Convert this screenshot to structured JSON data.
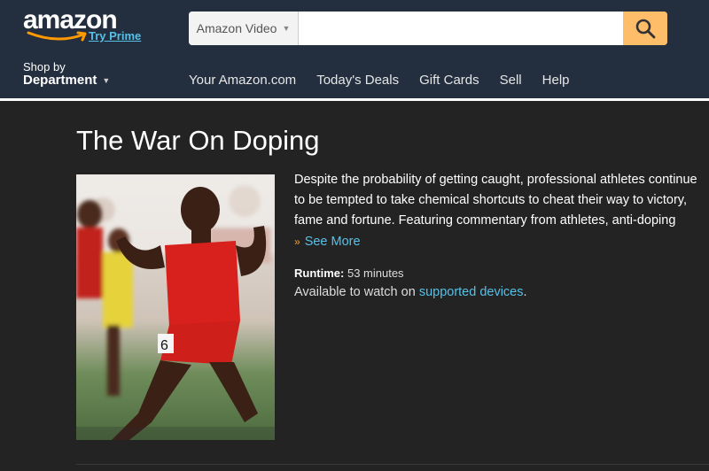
{
  "header": {
    "logo_text": "amazon",
    "try_prime": "Try Prime",
    "search": {
      "category": "Amazon Video",
      "placeholder": "",
      "value": ""
    },
    "shop_by": {
      "line1": "Shop by",
      "line2": "Department"
    },
    "nav": [
      "Your Amazon.com",
      "Today's Deals",
      "Gift Cards",
      "Sell",
      "Help"
    ]
  },
  "main": {
    "title": "The War On Doping",
    "synopsis": "Despite the probability of getting caught, professional athletes continue to be tempted to take chemical shortcuts to cheat their way to victory, fame and fortune. Featuring commentary from athletes, anti-doping",
    "see_more": "See More",
    "runtime_label": "Runtime:",
    "runtime_value": "53 minutes",
    "available_prefix": "Available to watch on",
    "available_link": "supported devices",
    "available_suffix": "."
  },
  "colors": {
    "header_bg": "#232f3e",
    "page_bg": "#232323",
    "link": "#57c1e8",
    "search_button": "#febd69"
  },
  "icons": {
    "search": "search-icon",
    "see_more": "chevron-double-down-icon",
    "dropdown": "caret-down-icon"
  }
}
